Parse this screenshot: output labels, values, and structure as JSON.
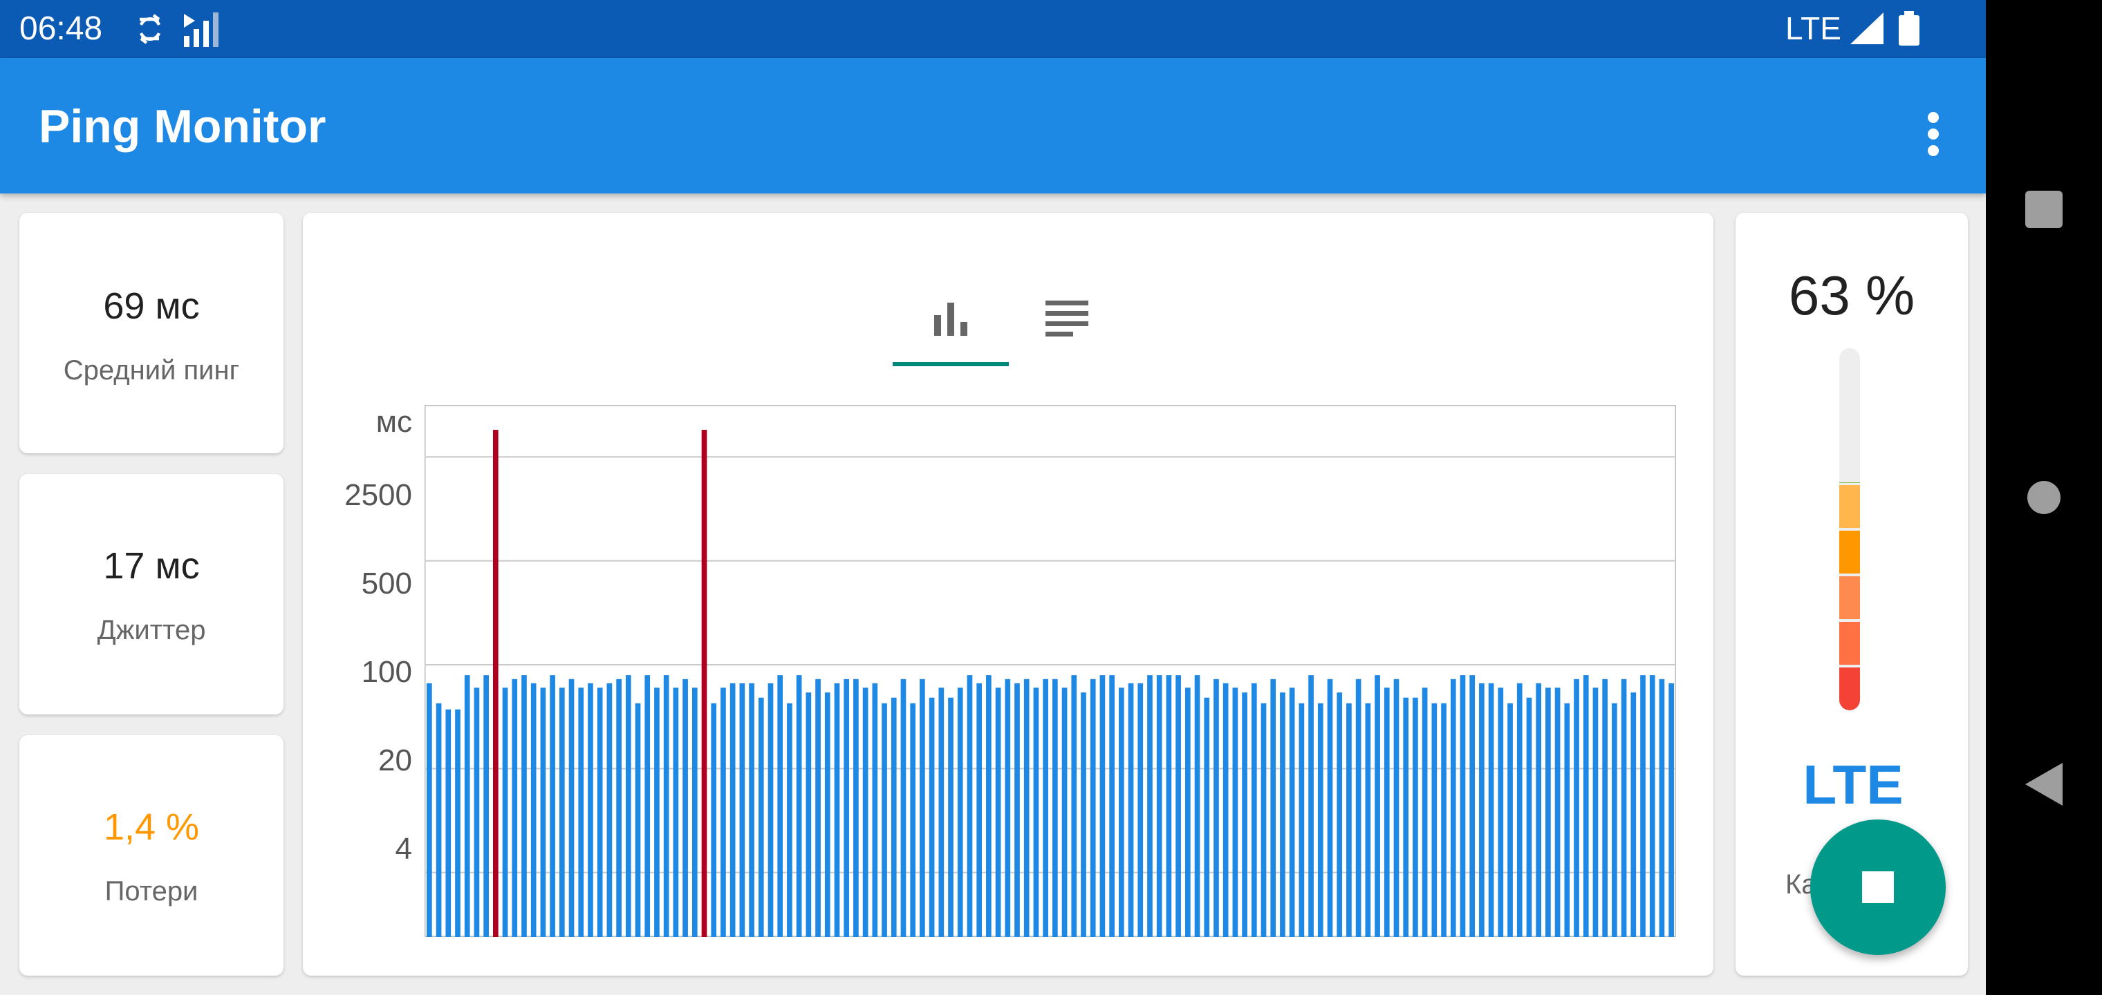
{
  "status_bar": {
    "time": "06:48",
    "network": "LTE"
  },
  "app": {
    "title": "Ping Monitor"
  },
  "stats": [
    {
      "value": "69 мс",
      "label": "Средний пинг"
    },
    {
      "value": "17 мс",
      "label": "Джиттер"
    },
    {
      "value": "1,4 %",
      "label": "Потери",
      "color": "#ff9800"
    }
  ],
  "chart_tabs": [
    {
      "icon": "bar-chart-icon",
      "selected": true
    },
    {
      "icon": "list-icon",
      "selected": false
    }
  ],
  "chart_data": {
    "type": "bar",
    "unit": "мс",
    "scale": "log",
    "y_ticks": [
      "2500",
      "500",
      "100",
      "20",
      "4"
    ],
    "grid": true,
    "series_color": "#1e88e5",
    "lost_color": "#b00020",
    "lost_indices": [
      7,
      29
    ],
    "values": [
      75,
      55,
      50,
      50,
      85,
      70,
      85,
      0,
      70,
      80,
      85,
      75,
      70,
      85,
      70,
      80,
      70,
      75,
      70,
      75,
      80,
      85,
      55,
      85,
      70,
      85,
      70,
      80,
      70,
      0,
      55,
      70,
      75,
      75,
      75,
      60,
      75,
      85,
      55,
      85,
      65,
      80,
      65,
      75,
      80,
      80,
      70,
      75,
      55,
      60,
      80,
      55,
      80,
      60,
      70,
      60,
      70,
      85,
      75,
      85,
      70,
      80,
      75,
      80,
      70,
      80,
      80,
      70,
      85,
      65,
      80,
      85,
      85,
      70,
      75,
      75,
      85,
      85,
      85,
      85,
      70,
      85,
      60,
      80,
      75,
      70,
      65,
      75,
      55,
      80,
      65,
      70,
      55,
      85,
      55,
      80,
      65,
      55,
      80,
      55,
      85,
      70,
      80,
      60,
      60,
      70,
      55,
      55,
      80,
      85,
      85,
      75,
      75,
      70,
      55,
      75,
      60,
      75,
      70,
      70,
      55,
      80,
      85,
      70,
      80,
      55,
      80,
      65,
      85,
      85,
      80,
      75
    ]
  },
  "signal": {
    "percent": "63 %",
    "level": 0.63,
    "network_type": "LTE",
    "label_partial": "Ка"
  }
}
